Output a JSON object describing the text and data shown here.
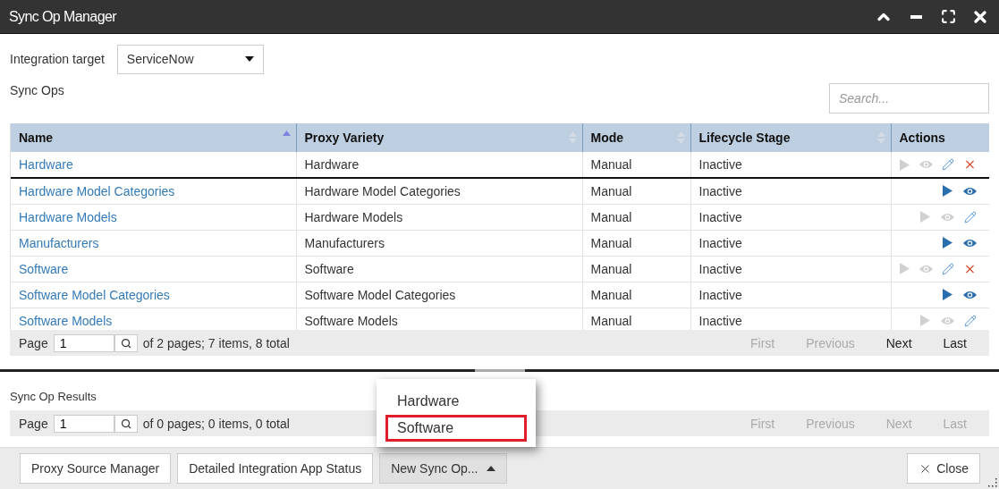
{
  "window": {
    "title": "Sync Op Manager"
  },
  "integration_target": {
    "label": "Integration target",
    "value": "ServiceNow"
  },
  "sync_ops": {
    "label": "Sync Ops",
    "search": {
      "placeholder": "Search..."
    },
    "columns": [
      {
        "label": "Name",
        "sorted": true
      },
      {
        "label": "Proxy Variety",
        "sorted": false
      },
      {
        "label": "Mode",
        "sorted": false
      },
      {
        "label": "Lifecycle Stage",
        "sorted": false
      },
      {
        "label": "Actions"
      }
    ],
    "rows": [
      {
        "name": "Hardware",
        "proxy_variety": "Hardware",
        "mode": "Manual",
        "lifecycle_stage": "Inactive",
        "actions": [
          {
            "kind": "run",
            "disabled": true
          },
          {
            "kind": "view",
            "disabled": true
          },
          {
            "kind": "edit",
            "disabled": false
          },
          {
            "kind": "delete",
            "disabled": false
          }
        ]
      },
      {
        "name": "Hardware Model Categories",
        "proxy_variety": "Hardware Model Categories",
        "mode": "Manual",
        "lifecycle_stage": "Inactive",
        "actions": [
          {
            "kind": "run",
            "disabled": false
          },
          {
            "kind": "view",
            "disabled": false
          }
        ]
      },
      {
        "name": "Hardware Models",
        "proxy_variety": "Hardware Models",
        "mode": "Manual",
        "lifecycle_stage": "Inactive",
        "actions": [
          {
            "kind": "run",
            "disabled": true
          },
          {
            "kind": "view",
            "disabled": true
          },
          {
            "kind": "edit",
            "disabled": false
          }
        ]
      },
      {
        "name": "Manufacturers",
        "proxy_variety": "Manufacturers",
        "mode": "Manual",
        "lifecycle_stage": "Inactive",
        "actions": [
          {
            "kind": "run",
            "disabled": false
          },
          {
            "kind": "view",
            "disabled": false
          }
        ]
      },
      {
        "name": "Software",
        "proxy_variety": "Software",
        "mode": "Manual",
        "lifecycle_stage": "Inactive",
        "actions": [
          {
            "kind": "run",
            "disabled": true
          },
          {
            "kind": "view",
            "disabled": true
          },
          {
            "kind": "edit",
            "disabled": false
          },
          {
            "kind": "delete",
            "disabled": false
          }
        ]
      },
      {
        "name": "Software Model Categories",
        "proxy_variety": "Software Model Categories",
        "mode": "Manual",
        "lifecycle_stage": "Inactive",
        "actions": [
          {
            "kind": "run",
            "disabled": false
          },
          {
            "kind": "view",
            "disabled": false
          }
        ]
      },
      {
        "name": "Software Models",
        "proxy_variety": "Software Models",
        "mode": "Manual",
        "lifecycle_stage": "Inactive",
        "actions": [
          {
            "kind": "run",
            "disabled": true
          },
          {
            "kind": "view",
            "disabled": true
          },
          {
            "kind": "edit",
            "disabled": false
          }
        ]
      }
    ],
    "pager": {
      "label": "Page",
      "page": "1",
      "summary": "of 2 pages; 7 items, 8 total",
      "links": [
        {
          "label": "First",
          "disabled": true
        },
        {
          "label": "Previous",
          "disabled": true
        },
        {
          "label": "Next",
          "disabled": false
        },
        {
          "label": "Last",
          "disabled": false
        }
      ]
    }
  },
  "sync_op_results": {
    "label": "Sync Op Results",
    "pager": {
      "label": "Page",
      "page": "1",
      "summary": "of 0 pages; 0 items, 0 total",
      "links": [
        {
          "label": "First",
          "disabled": true
        },
        {
          "label": "Previous",
          "disabled": true
        },
        {
          "label": "Next",
          "disabled": true
        },
        {
          "label": "Last",
          "disabled": true
        }
      ]
    }
  },
  "footer": {
    "buttons": [
      {
        "label": "Proxy Source Manager",
        "kind": "plain"
      },
      {
        "label": "Detailed Integration App Status",
        "kind": "plain"
      },
      {
        "label": "New Sync Op...",
        "kind": "menu",
        "expanded": true
      }
    ],
    "menu": [
      {
        "label": "Hardware",
        "selected": false
      },
      {
        "label": "Software",
        "selected": true
      }
    ],
    "close": {
      "label": "Close"
    }
  }
}
